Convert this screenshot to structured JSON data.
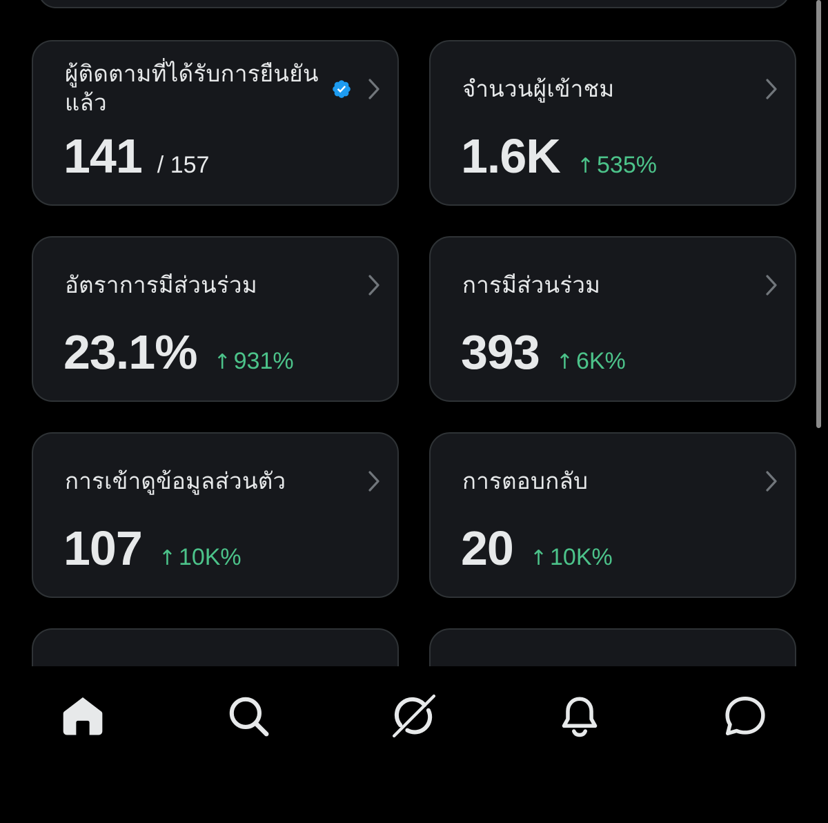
{
  "cards": [
    {
      "title": "ผู้ติดตามที่ได้รับการยืนยันแล้ว",
      "value": "141",
      "total": "/ 157",
      "verified": true,
      "icon": "verified-badge"
    },
    {
      "title": "จำนวนผู้เข้าชม",
      "value": "1.6K",
      "change": "535%",
      "change_color": "#4cc38a"
    },
    {
      "title": "อัตราการมีส่วนร่วม",
      "value": "23.1%",
      "change": "931%",
      "change_color": "#4cc38a"
    },
    {
      "title": "การมีส่วนร่วม",
      "value": "393",
      "change": "6K%",
      "change_color": "#4cc38a"
    },
    {
      "title": "การเข้าดูข้อมูลส่วนตัว",
      "value": "107",
      "change": "10K%",
      "change_color": "#4cc38a"
    },
    {
      "title": "การตอบกลับ",
      "value": "20",
      "change": "10K%",
      "change_color": "#4cc38a"
    }
  ],
  "tab_bar": {
    "items": [
      {
        "name": "home",
        "icon": "home-icon",
        "active": true
      },
      {
        "name": "search",
        "icon": "search-icon",
        "active": false
      },
      {
        "name": "grok",
        "icon": "grok-icon",
        "active": false
      },
      {
        "name": "notifications",
        "icon": "bell-icon",
        "active": false
      },
      {
        "name": "messages",
        "icon": "message-icon",
        "active": false
      }
    ]
  },
  "colors": {
    "background": "#000000",
    "card": "#16181c",
    "card_border": "#2f3336",
    "text": "#e7e9ea",
    "positive": "#4cc38a",
    "verified": "#1d9bf0"
  }
}
